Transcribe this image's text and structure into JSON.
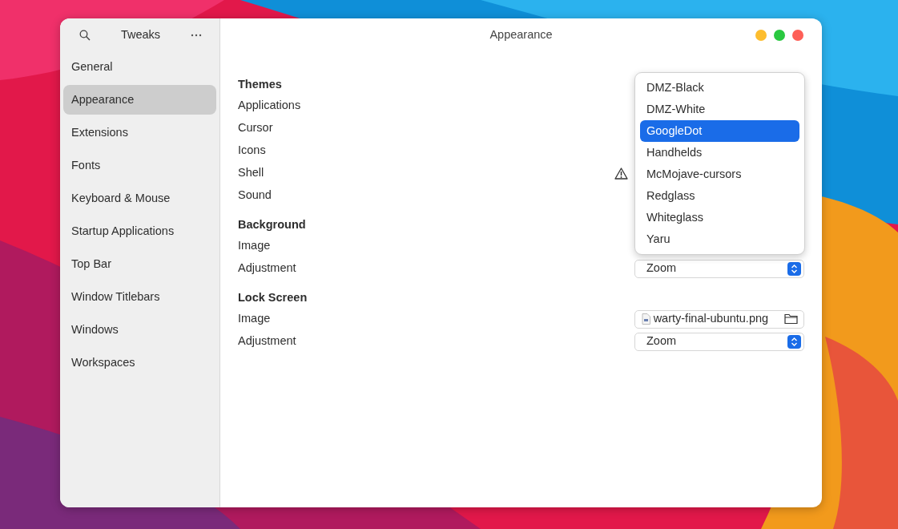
{
  "window": {
    "title": "Appearance"
  },
  "sidebar": {
    "title": "Tweaks",
    "items": [
      {
        "label": "General",
        "selected": false
      },
      {
        "label": "Appearance",
        "selected": true
      },
      {
        "label": "Extensions",
        "selected": false
      },
      {
        "label": "Fonts",
        "selected": false
      },
      {
        "label": "Keyboard & Mouse",
        "selected": false
      },
      {
        "label": "Startup Applications",
        "selected": false
      },
      {
        "label": "Top Bar",
        "selected": false
      },
      {
        "label": "Window Titlebars",
        "selected": false
      },
      {
        "label": "Windows",
        "selected": false
      },
      {
        "label": "Workspaces",
        "selected": false
      }
    ]
  },
  "sections": [
    {
      "heading": "Themes",
      "rows": [
        {
          "label": "Applications",
          "warning": false
        },
        {
          "label": "Cursor",
          "warning": false
        },
        {
          "label": "Icons",
          "warning": false
        },
        {
          "label": "Shell",
          "warning": true
        },
        {
          "label": "Sound",
          "warning": false
        }
      ]
    },
    {
      "heading": "Background",
      "rows": [
        {
          "label": "Image",
          "warning": false
        },
        {
          "label": "Adjustment",
          "warning": false,
          "control": {
            "kind": "dropdown",
            "value": "Zoom"
          }
        }
      ]
    },
    {
      "heading": "Lock Screen",
      "rows": [
        {
          "label": "Image",
          "warning": false,
          "control": {
            "kind": "file",
            "value": "warty-final-ubuntu.png"
          }
        },
        {
          "label": "Adjustment",
          "warning": false,
          "control": {
            "kind": "dropdown",
            "value": "Zoom"
          }
        }
      ]
    }
  ],
  "popup": {
    "items": [
      {
        "label": "DMZ-Black",
        "selected": false
      },
      {
        "label": "DMZ-White",
        "selected": false
      },
      {
        "label": "GoogleDot",
        "selected": true
      },
      {
        "label": "Handhelds",
        "selected": false
      },
      {
        "label": "McMojave-cursors",
        "selected": false
      },
      {
        "label": "Redglass",
        "selected": false
      },
      {
        "label": "Whiteglass",
        "selected": false
      },
      {
        "label": "Yaru",
        "selected": false
      }
    ]
  }
}
